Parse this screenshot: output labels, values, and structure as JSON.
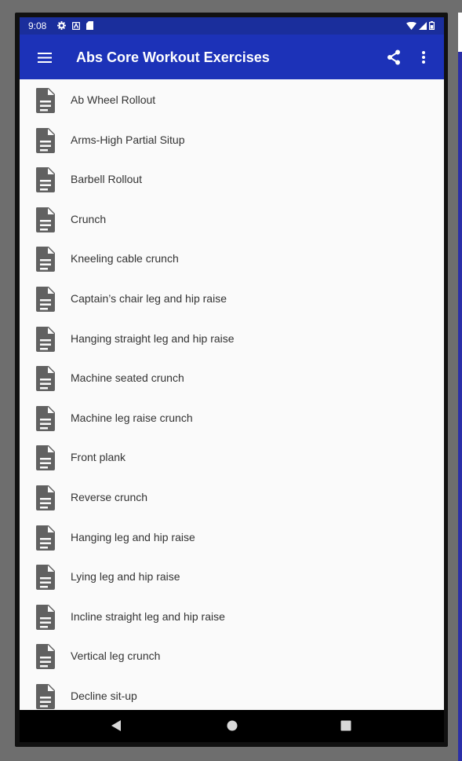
{
  "status_bar": {
    "time": "9:08",
    "left_icons": [
      "settings-icon",
      "notification-icon",
      "sd-card-icon"
    ],
    "right_icons": [
      "wifi-icon",
      "signal-icon",
      "battery-icon"
    ]
  },
  "app_bar": {
    "title": "Abs Core Workout Exercises",
    "menu_icon": "hamburger-menu-icon",
    "share_icon": "share-icon",
    "more_icon": "more-vert-icon"
  },
  "colors": {
    "status_bar": "#1a2e9c",
    "app_bar": "#1c32b8",
    "list_bg": "#fafafa",
    "icon": "#616161",
    "text": "#333333"
  },
  "exercises": [
    "Ab Wheel Rollout",
    "Arms-High Partial Situp",
    "Barbell Rollout",
    "Crunch",
    "Kneeling cable crunch",
    "Captain’s chair leg and hip raise",
    "Hanging straight leg and hip raise",
    "Machine seated crunch",
    "Machine leg raise crunch",
    "Front plank",
    "Reverse crunch",
    "Hanging leg and hip raise",
    "Lying leg and hip raise",
    "Incline straight leg and hip raise",
    "Vertical leg crunch",
    "Decline sit-up"
  ],
  "nav_bar": {
    "back_icon": "back-triangle-icon",
    "home_icon": "home-circle-icon",
    "recents_icon": "recents-square-icon"
  }
}
